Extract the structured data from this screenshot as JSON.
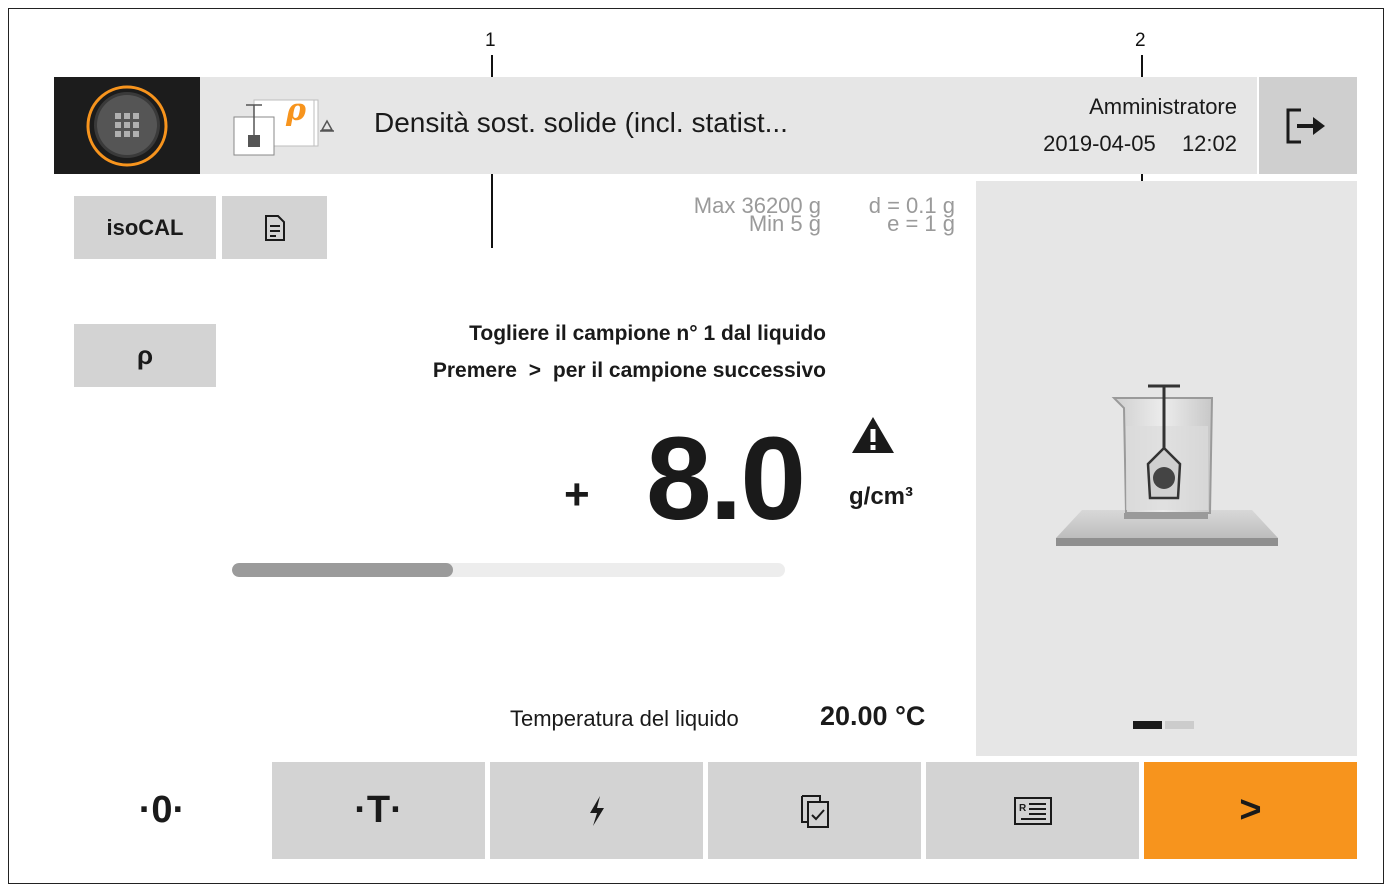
{
  "callouts": [
    "1",
    "2"
  ],
  "header": {
    "app_title": "Densità sost. solide (incl. statist...",
    "user": "Amministratore",
    "date": "2019-04-05",
    "time": "12:02",
    "app_icon_symbol": "ρ",
    "menu_icon": "grid-icon",
    "logout_icon": "logout-icon"
  },
  "left_buttons": {
    "isocal": "isoCAL",
    "doc_icon": "document-icon",
    "rho": "ρ"
  },
  "specs": {
    "max": "Max 36200 g",
    "min": "Min 5 g",
    "d": "d = 0.1 g",
    "e": "e = 1 g"
  },
  "instructions": {
    "line1": "Togliere il campione n° 1 dal liquido",
    "line2_pre": "Premere",
    "line2_symbol": ">",
    "line2_post": "per il campione successivo"
  },
  "reading": {
    "sign": "+",
    "value": "8.0",
    "unit": "g/cm³",
    "warning_icon": "warning-icon",
    "progress": 0.4
  },
  "temperature": {
    "label": "Temperatura del liquido",
    "value": "20.00 °C"
  },
  "side_panel": {
    "image": "beaker-on-balance-illustration",
    "pages": 2,
    "active_page": 1
  },
  "footer": {
    "zero": "·0·",
    "tare": "·T·",
    "flash_icon": "flash-icon",
    "checklist_icon": "checklist-icon",
    "report_icon": "report-icon",
    "next": ">"
  },
  "colors": {
    "accent": "#f7941d",
    "button": "#d3d3d3",
    "header": "#e6e6e6",
    "dark": "#1c1c1c"
  }
}
